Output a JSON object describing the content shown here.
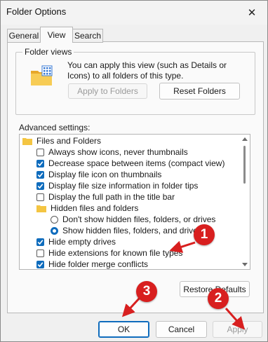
{
  "window": {
    "title": "Folder Options",
    "close_glyph": "✕"
  },
  "tabs": [
    {
      "label": "General",
      "active": false
    },
    {
      "label": "View",
      "active": true
    },
    {
      "label": "Search",
      "active": false
    }
  ],
  "folder_views": {
    "group_label": "Folder views",
    "description": "You can apply this view (such as Details or Icons) to all folders of this type.",
    "apply_button": "Apply to Folders",
    "reset_button": "Reset Folders",
    "icon": "folder-view-icon"
  },
  "advanced": {
    "label": "Advanced settings:",
    "items": [
      {
        "type": "folder",
        "label": "Files and Folders",
        "level": 0
      },
      {
        "type": "checkbox",
        "label": "Always show icons, never thumbnails",
        "checked": false,
        "level": 1
      },
      {
        "type": "checkbox",
        "label": "Decrease space between items (compact view)",
        "checked": true,
        "level": 1
      },
      {
        "type": "checkbox",
        "label": "Display file icon on thumbnails",
        "checked": true,
        "level": 1
      },
      {
        "type": "checkbox",
        "label": "Display file size information in folder tips",
        "checked": true,
        "level": 1
      },
      {
        "type": "checkbox",
        "label": "Display the full path in the title bar",
        "checked": false,
        "level": 1
      },
      {
        "type": "folder",
        "label": "Hidden files and folders",
        "level": 1
      },
      {
        "type": "radio",
        "label": "Don't show hidden files, folders, or drives",
        "checked": false,
        "level": 2
      },
      {
        "type": "radio",
        "label": "Show hidden files, folders, and drives",
        "checked": true,
        "level": 2
      },
      {
        "type": "checkbox",
        "label": "Hide empty drives",
        "checked": true,
        "level": 1
      },
      {
        "type": "checkbox",
        "label": "Hide extensions for known file types",
        "checked": false,
        "level": 1
      },
      {
        "type": "checkbox",
        "label": "Hide folder merge conflicts",
        "checked": true,
        "level": 1
      }
    ]
  },
  "restore_defaults": "Restore Defaults",
  "footer": {
    "ok": "OK",
    "cancel": "Cancel",
    "apply": "Apply"
  },
  "callouts": [
    "1",
    "2",
    "3"
  ],
  "colors": {
    "accent": "#0f6cbd",
    "callout": "#d81f1f",
    "folder": "#f4c542"
  }
}
